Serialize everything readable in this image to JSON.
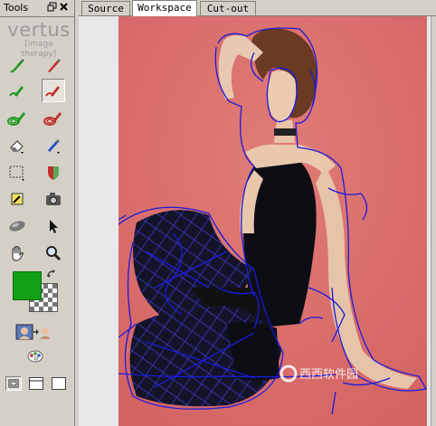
{
  "tools_panel": {
    "title": "Tools",
    "brand_name": "vertus",
    "brand_tagline": "[image therapy]",
    "pin_icon": "restore-icon",
    "close_icon": "close-icon"
  },
  "tools": [
    {
      "name": "keep-brush-icon",
      "color": "#1e9a1e"
    },
    {
      "name": "remove-brush-icon",
      "color": "#c0302a"
    },
    {
      "name": "keep-edge-brush-icon",
      "color": "#1e9a1e"
    },
    {
      "name": "remove-edge-brush-icon",
      "color": "#c0302a"
    },
    {
      "name": "keep-fill-icon",
      "color": "#1e9a1e"
    },
    {
      "name": "remove-fill-icon",
      "color": "#c0302a"
    },
    {
      "name": "eraser-icon",
      "color": "#555555"
    },
    {
      "name": "blue-brush-icon",
      "color": "#2850c8"
    },
    {
      "name": "selection-icon",
      "color": "#333333"
    },
    {
      "name": "shield-icon",
      "color": "#c0302a"
    },
    {
      "name": "magic-wand-icon",
      "color": "#333333"
    },
    {
      "name": "camera-icon",
      "color": "#444444"
    },
    {
      "name": "smudge-icon",
      "color": "#555555"
    },
    {
      "name": "pointer-icon",
      "color": "#222222"
    },
    {
      "name": "hand-icon",
      "color": "#333333"
    },
    {
      "name": "zoom-icon",
      "color": "#333333"
    }
  ],
  "colors": {
    "foreground": "#14a014",
    "canvas_bg": "#d96868",
    "outline": "#1a1adc"
  },
  "extra_tools": [
    "compare-icon",
    "palette-icon"
  ],
  "view_buttons": [
    "view-single-icon",
    "view-split-icon",
    "view-full-icon"
  ],
  "tabs": [
    {
      "label": "Source",
      "selected": false
    },
    {
      "label": "Workspace",
      "selected": true
    },
    {
      "label": "Cut-out",
      "selected": false
    }
  ],
  "watermark": "西西软件园"
}
